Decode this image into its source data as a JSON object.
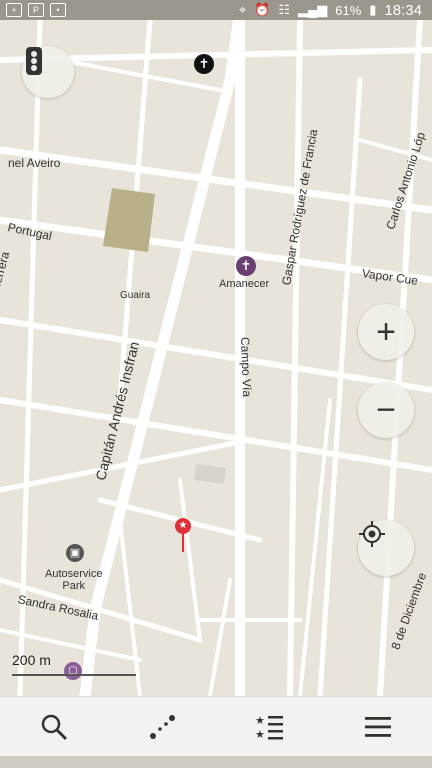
{
  "status_bar": {
    "battery": "61%",
    "time": "18:34",
    "app_icons": [
      "plus-box-icon",
      "p-box-icon",
      "notification-icon"
    ],
    "system_icons": [
      "location-pin-icon",
      "alarm-icon",
      "wifi-icon",
      "signal-icon",
      "battery-icon"
    ]
  },
  "map": {
    "streets": {
      "aveiro": "nel Aveiro",
      "portugal": "Portugal",
      "herrera": "o de Herrera",
      "capitan": "Capitán Andrés Insfran",
      "campo_via": "Campo Vía",
      "gaspar": "Gaspar Rodríguez de Francia",
      "carlos": "Carlos Antonio Lóp",
      "vapor": "Vapor Cue",
      "sandra": "Sandra Rosalia",
      "diciembre": "8 de Diciembre"
    },
    "places": {
      "guaira": "Guaira",
      "amanecer": "Amanecer",
      "autoservice": "Autoservice",
      "autoservice_line2": "Park"
    },
    "scale_label": "200 m"
  },
  "controls": {
    "traffic": "traffic-light-icon",
    "zoom_in": "+",
    "zoom_out": "−",
    "locate": "my-location-icon"
  },
  "bottom_bar": {
    "items": [
      "search-icon",
      "route-icon",
      "bookmarks-icon",
      "menu-icon"
    ]
  },
  "colors": {
    "map_bg": "#e8e4d9",
    "road": "#ffffff",
    "park": "#b9b08a",
    "marker_red": "#e0303a",
    "poi_purple": "#6a3f72"
  }
}
